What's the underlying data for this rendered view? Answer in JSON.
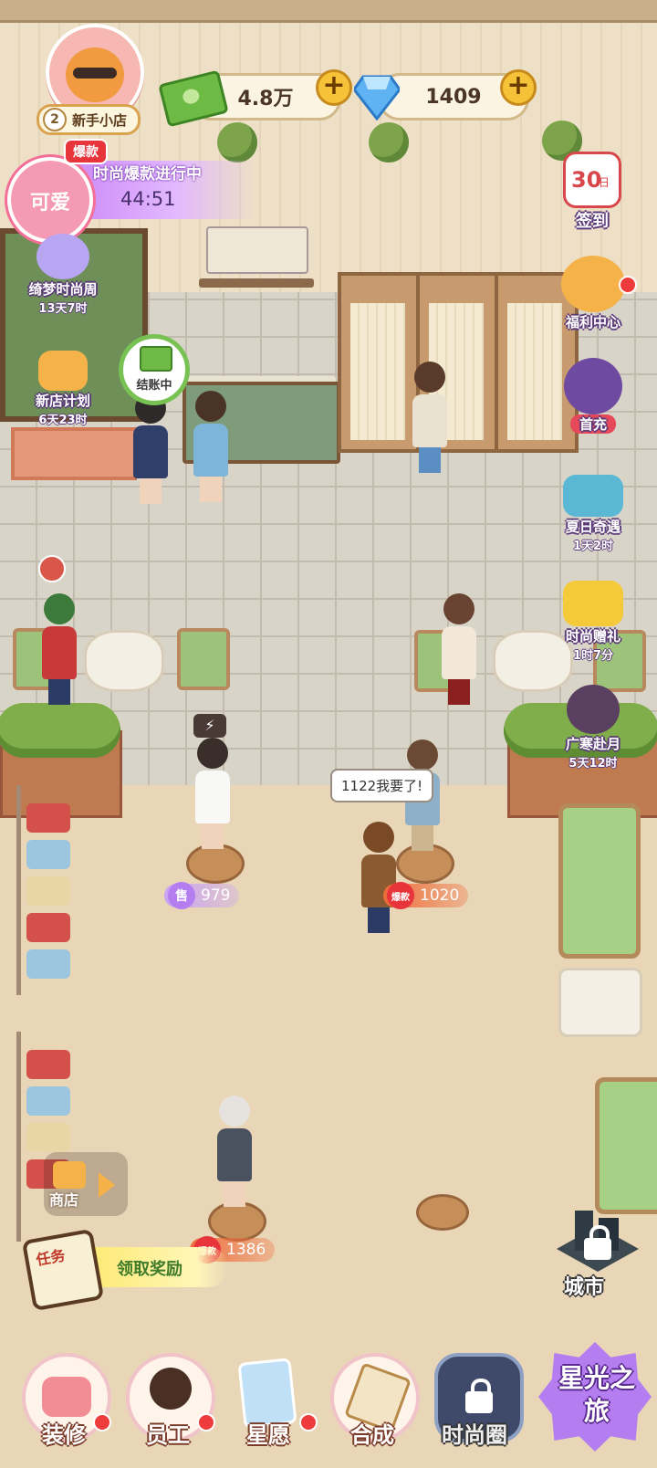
{
  "player": {
    "level": "2",
    "shop_name": "新手小店"
  },
  "resources": {
    "cash": "4.8万",
    "diamonds": "1409"
  },
  "event": {
    "hot_tag": "爆款",
    "bubble_label": "可爱",
    "title": "时尚爆款进行中",
    "timer": "44:51"
  },
  "left_side": [
    {
      "label": "绮梦时尚周",
      "sub": "13天7时"
    },
    {
      "label": "新店计划",
      "sub": "6天23时"
    }
  ],
  "right_side": {
    "signin": {
      "day": "30",
      "day_unit": "日",
      "label": "签到"
    },
    "welfare": {
      "label": "福利中心"
    },
    "first_charge": {
      "label": "首充"
    },
    "summer": {
      "label": "夏日奇遇",
      "sub": "1天2时"
    },
    "gift": {
      "label": "时尚赠礼",
      "sub": "1时7分"
    },
    "moon": {
      "label": "广寒赴月",
      "sub": "5天12时"
    }
  },
  "checkout": {
    "label": "结账中"
  },
  "speech": "1122我要了!",
  "price_tags": [
    {
      "icon": "售",
      "value": "979",
      "color": "#b57ef0"
    },
    {
      "icon": "爆款",
      "value": "1020",
      "color": "#ef6c3c"
    },
    {
      "icon": "爆款",
      "value": "1386",
      "color": "#ef6c3c"
    }
  ],
  "shop_button": "商店",
  "task": {
    "icon_text": "任务",
    "label": "领取奖励"
  },
  "city": {
    "label": "城市"
  },
  "nav": [
    {
      "label": "装修"
    },
    {
      "label": "员工"
    },
    {
      "label": "星愿"
    },
    {
      "label": "合成"
    },
    {
      "label": "时尚圈"
    }
  ],
  "star_journey": "星光之旅",
  "colors": {
    "accent_purple": "#b57ef0",
    "hot_red": "#e8353c",
    "coin_gold": "#f6c338",
    "cash_green": "#6dbb45"
  }
}
